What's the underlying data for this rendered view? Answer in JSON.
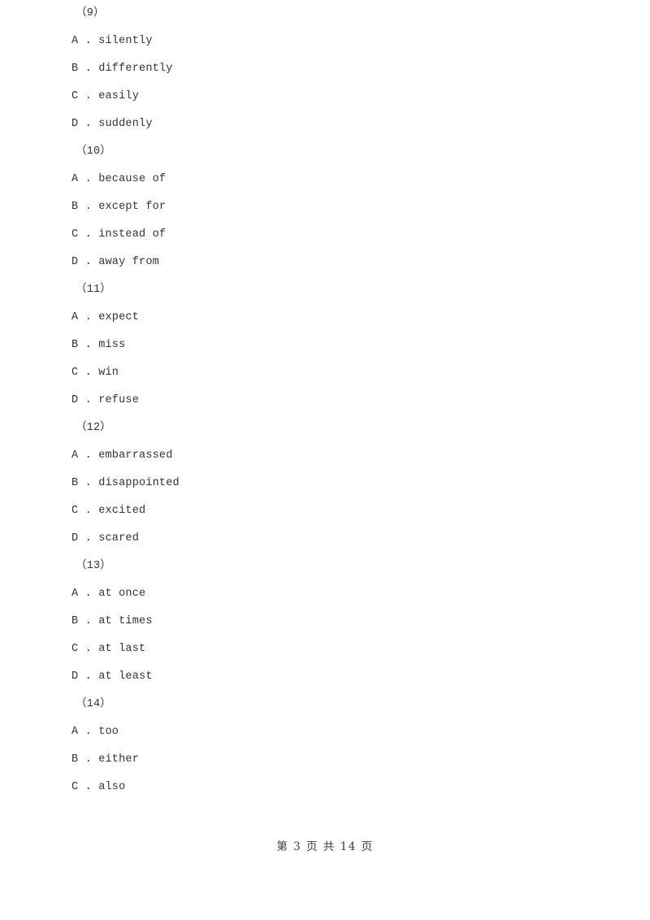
{
  "document": {
    "type": "exam-paper",
    "background_color": "#ffffff",
    "text_color": "#333333"
  },
  "questions": [
    {
      "number": "（9）",
      "options": [
        "A . silently",
        "B . differently",
        "C . easily",
        "D . suddenly"
      ]
    },
    {
      "number": "（10）",
      "options": [
        "A . because of",
        "B . except for",
        "C . instead of",
        "D . away from"
      ]
    },
    {
      "number": "（11）",
      "options": [
        "A . expect",
        "B . miss",
        "C . win",
        "D . refuse"
      ]
    },
    {
      "number": "（12）",
      "options": [
        "A . embarrassed",
        "B . disappointed",
        "C . excited",
        "D . scared"
      ]
    },
    {
      "number": "（13）",
      "options": [
        "A . at once",
        "B . at times",
        "C . at last",
        "D . at least"
      ]
    },
    {
      "number": "（14）",
      "options": [
        "A . too",
        "B . either",
        "C . also"
      ]
    }
  ],
  "footer": {
    "text": "第 3 页 共 14 页",
    "current_page": "3",
    "total_pages": "14"
  }
}
